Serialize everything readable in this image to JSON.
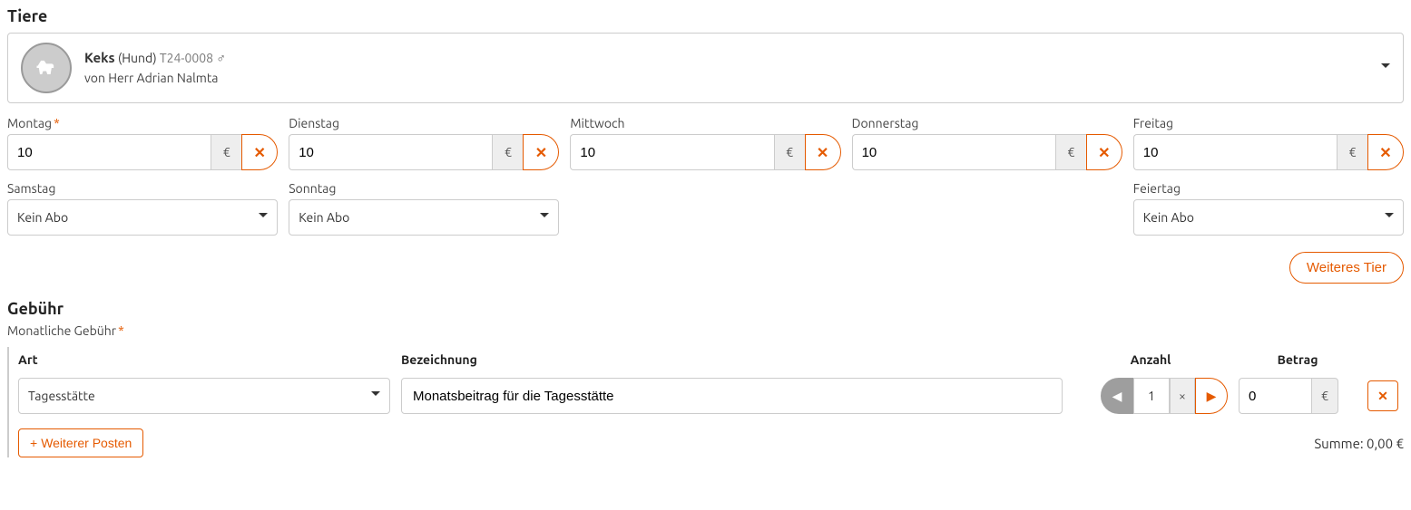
{
  "tiere": {
    "title": "Tiere",
    "animal": {
      "name": "Keks",
      "species": "(Hund)",
      "id": "T24-0008",
      "owner_line": "von Herr Adrian Nalmta"
    },
    "days": {
      "montag": {
        "label": "Montag",
        "value": "10",
        "unit": "€"
      },
      "dienstag": {
        "label": "Dienstag",
        "value": "10",
        "unit": "€"
      },
      "mittwoch": {
        "label": "Mittwoch",
        "value": "10",
        "unit": "€"
      },
      "donnerstag": {
        "label": "Donnerstag",
        "value": "10",
        "unit": "€"
      },
      "freitag": {
        "label": "Freitag",
        "value": "10",
        "unit": "€"
      }
    },
    "weekend": {
      "samstag": {
        "label": "Samstag",
        "value": "Kein Abo"
      },
      "sonntag": {
        "label": "Sonntag",
        "value": "Kein Abo"
      },
      "feiertag": {
        "label": "Feiertag",
        "value": "Kein Abo"
      }
    },
    "add_animal_btn": "Weiteres Tier"
  },
  "fee": {
    "title": "Gebühr",
    "subtitle": "Monatliche Gebühr",
    "columns": {
      "art": "Art",
      "bez": "Bezeichnung",
      "anzahl": "Anzahl",
      "betrag": "Betrag"
    },
    "row": {
      "art": "Tagesstätte",
      "bez": "Monatsbeitrag für die Tagesstätte",
      "qty": "1",
      "qty_symbol": "×",
      "amount": "0",
      "unit": "€"
    },
    "add_item_btn": "Weiterer Posten",
    "sum_label": "Summe: 0,00 €"
  },
  "icons": {
    "x": "✕",
    "plus": "+",
    "arrow_l": "◀",
    "arrow_r": "▶"
  }
}
